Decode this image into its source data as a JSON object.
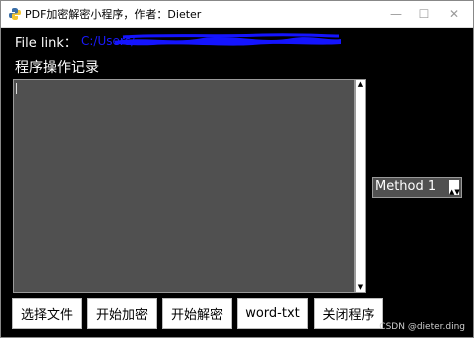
{
  "window": {
    "title": "PDF加密解密小程序，作者：Dieter",
    "min_glyph": "—",
    "max_glyph": "☐",
    "close_glyph": "✕",
    "app_icon": "python-icon"
  },
  "file_link": {
    "label": "File link：",
    "value": "C:/Users/"
  },
  "log": {
    "label": "程序操作记录",
    "content": ""
  },
  "method_select": {
    "value": "Method 1",
    "arrow": "▲▼"
  },
  "buttons": {
    "select_file": "选择文件",
    "start_encrypt": "开始加密",
    "start_decrypt": "开始解密",
    "word_txt": "word-txt",
    "close_program": "关闭程序"
  },
  "watermark": "CSDN @dieter.ding",
  "colors": {
    "background": "#000000",
    "text_area": "#505050",
    "redaction": "#1414ff"
  }
}
